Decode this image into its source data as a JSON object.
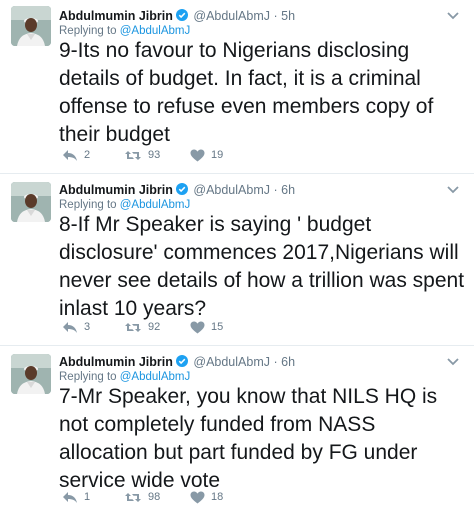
{
  "tweets": [
    {
      "author_name": "Abdulmumin Jibrin",
      "handle": "@AbdulAbmJ",
      "dot": "·",
      "time": "5h",
      "replying_prefix": "Replying to",
      "replying_to": "@AbdulAbmJ",
      "text": "9-Its no favour to Nigerians disclosing details of budget. In fact, it is a criminal offense to refuse even members copy of their budget",
      "replies": "2",
      "retweets": "93",
      "likes": "19"
    },
    {
      "author_name": "Abdulmumin Jibrin",
      "handle": "@AbdulAbmJ",
      "dot": "·",
      "time": "6h",
      "replying_prefix": "Replying to",
      "replying_to": "@AbdulAbmJ",
      "text": "8-If Mr Speaker is saying ' budget disclosure' commences 2017,Nigerians will never see details of how a trillion was spent inlast 10 years?",
      "replies": "3",
      "retweets": "92",
      "likes": "15"
    },
    {
      "author_name": "Abdulmumin Jibrin",
      "handle": "@AbdulAbmJ",
      "dot": "·",
      "time": "6h",
      "replying_prefix": "Replying to",
      "replying_to": "@AbdulAbmJ",
      "text": "7-Mr Speaker, you know that NILS HQ is not completely funded from NASS allocation but part funded by FG under service wide vote",
      "replies": "1",
      "retweets": "98",
      "likes": "18"
    }
  ],
  "icons": {
    "verified": "verified-badge-icon",
    "caret": "chevron-down-icon",
    "reply": "reply-icon",
    "retweet": "retweet-icon",
    "like": "heart-icon"
  },
  "colors": {
    "verified": "#1da1f2",
    "link": "#1b95e0",
    "muted": "#657786",
    "text": "#14171a",
    "icon": "#8899a6"
  }
}
